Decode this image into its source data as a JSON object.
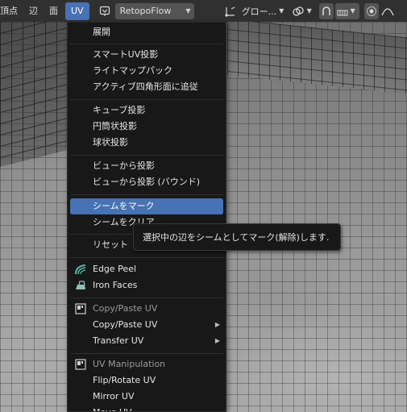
{
  "header": {
    "menus": [
      "頂点",
      "辺",
      "面",
      "UV"
    ],
    "retopoflow_label": "RetopoFlow",
    "pivot_label": "グロー..."
  },
  "menu": {
    "items": [
      {
        "label": "展開"
      },
      {
        "label": "スマートUV投影"
      },
      {
        "label": "ライトマップパック"
      },
      {
        "label": "アクティブ四角形面に追従"
      },
      {
        "label": "キューブ投影"
      },
      {
        "label": "円筒状投影"
      },
      {
        "label": "球状投影"
      },
      {
        "label": "ビューから投影"
      },
      {
        "label": "ビューから投影 (バウンド)"
      },
      {
        "label": "シームをマーク"
      },
      {
        "label": "シームをクリア"
      },
      {
        "label": "リセット"
      },
      {
        "label": "Edge Peel"
      },
      {
        "label": "Iron Faces"
      },
      {
        "label": "Copy/Paste UV"
      },
      {
        "label": "Copy/Paste UV"
      },
      {
        "label": "Transfer UV"
      },
      {
        "label": "UV Manipulation"
      },
      {
        "label": "Flip/Rotate UV"
      },
      {
        "label": "Mirror UV"
      },
      {
        "label": "Move UV"
      }
    ]
  },
  "tooltip": {
    "text": "選択中の辺をシームとしてマーク(解除)します."
  },
  "colors": {
    "accent": "#4772b3",
    "menu_bg": "#181818",
    "header_bg": "#303030"
  }
}
